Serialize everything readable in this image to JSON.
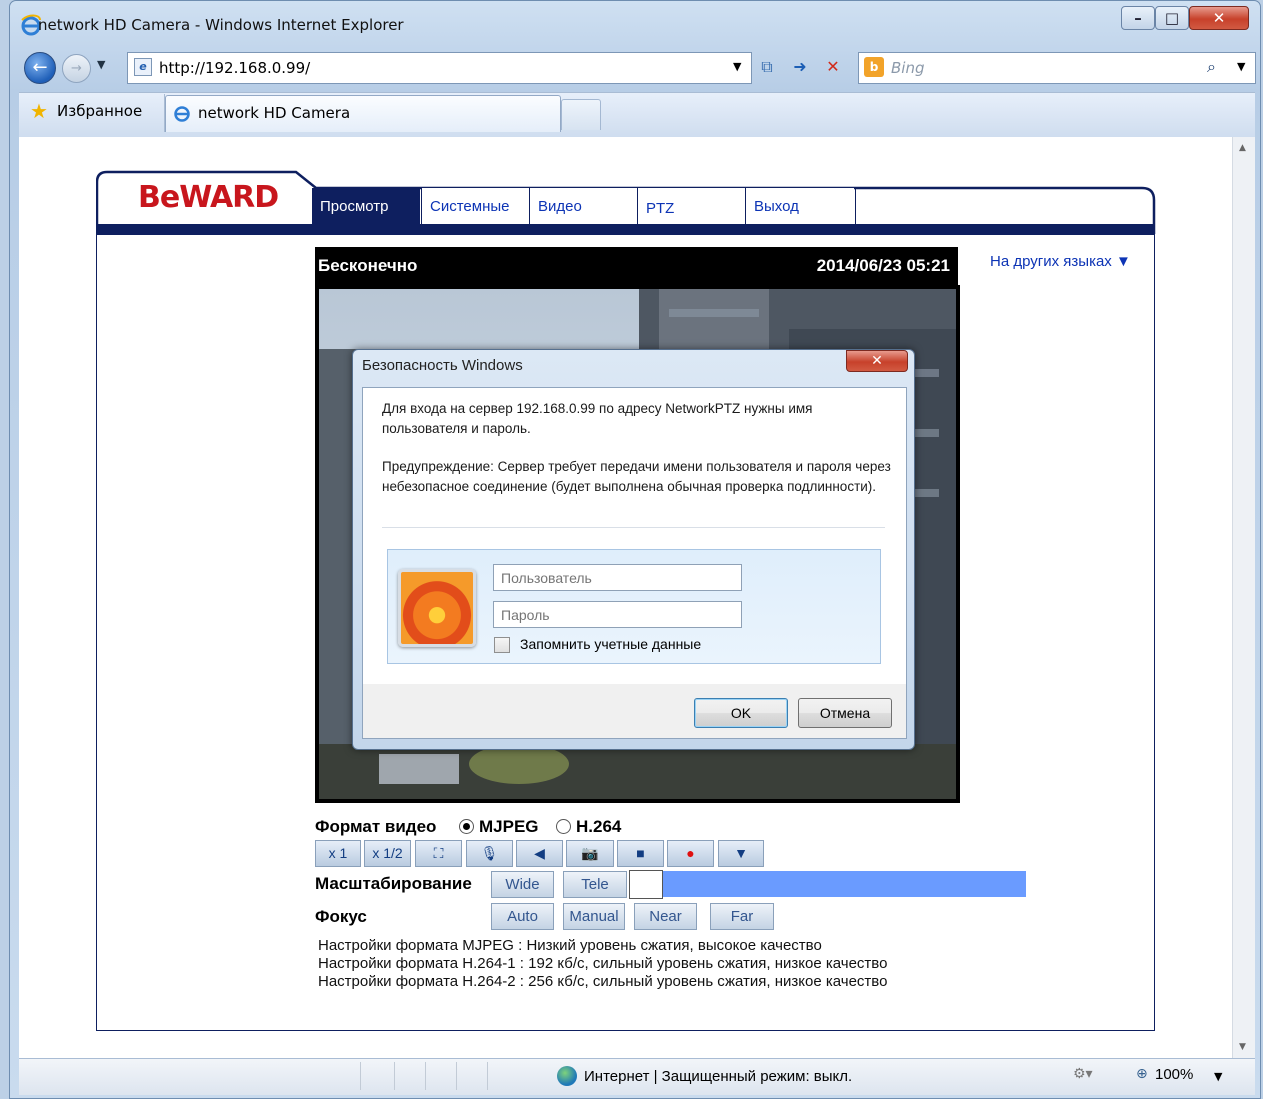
{
  "window": {
    "title": "network HD Camera - Windows Internet Explorer"
  },
  "toolbar": {
    "url": "http://192.168.0.99/",
    "search_placeholder": "Bing"
  },
  "favorites": {
    "label": "Избранное"
  },
  "tab": {
    "label": "network HD Camera"
  },
  "page": {
    "logo": "BeWARD",
    "nav": [
      "Просмотр",
      "Системные",
      "Видео",
      "PTZ",
      "Выход"
    ],
    "language_link": "На других языках ▼",
    "video": {
      "title": "Бесконечно",
      "timestamp": "2014/06/23 05:21"
    },
    "format_label": "Формат видео",
    "formats": [
      "MJPEG",
      "H.264"
    ],
    "selected_format": "MJPEG",
    "controls": [
      "x 1",
      "x 1/2"
    ],
    "zoom_label": "Масштабирование",
    "zoom_buttons": [
      "Wide",
      "Tele"
    ],
    "focus_label": "Фокус",
    "focus_buttons": [
      "Auto",
      "Manual",
      "Near",
      "Far"
    ],
    "info": [
      "Настройки формата MJPEG : Низкий уровень сжатия, высокое качество",
      "Настройки формата H.264-1 : 192 кб/с, сильный уровень сжатия, низкое качество",
      "Настройки формата H.264-2 : 256 кб/с, сильный уровень сжатия, низкое качество"
    ]
  },
  "dialog": {
    "title": "Безопасность Windows",
    "message": "Для входа на сервер 192.168.0.99   по адресу NetworkPTZ нужны имя пользователя и пароль.",
    "warning": "Предупреждение: Сервер требует передачи имени пользователя и пароля через небезопасное соединение (будет выполнена обычная проверка подлинности).",
    "username_placeholder": "Пользователь",
    "password_placeholder": "Пароль",
    "remember_label": "Запомнить учетные данные",
    "ok_label": "OK",
    "cancel_label": "Отмена"
  },
  "status": {
    "zone": "Интернет | Защищенный режим: выкл.",
    "zoom": "100%"
  },
  "colors": {
    "nav_dark": "#0e1f5f",
    "link_blue": "#0d34b5",
    "logo_red": "#c8161d",
    "zoom_bar": "#6a9bff"
  }
}
